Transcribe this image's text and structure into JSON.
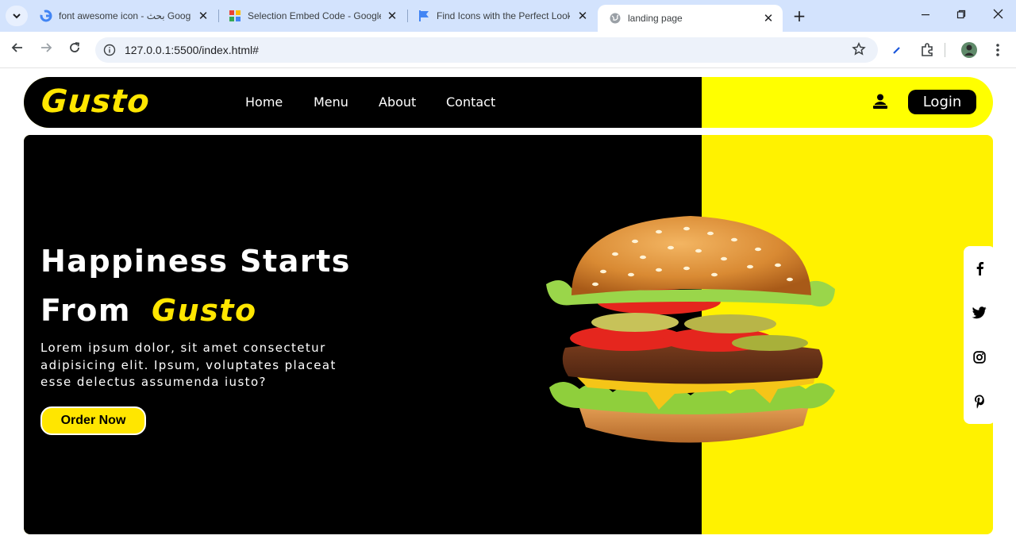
{
  "browser": {
    "tabs": [
      {
        "title": "font awesome icon - بحث Goog",
        "favicon": "google-g-icon",
        "active": false
      },
      {
        "title": "Selection Embed Code - Google",
        "favicon": "google-fonts-icon",
        "active": false
      },
      {
        "title": "Find Icons with the Perfect Look",
        "favicon": "flag-icon",
        "active": false
      },
      {
        "title": "landing page",
        "favicon": "globe-icon",
        "active": true
      }
    ],
    "close_glyph": "✕",
    "new_tab_glyph": "+",
    "url": "127.0.0.1:5500/index.html#"
  },
  "navbar": {
    "logo": "Gusto",
    "links": [
      "Home",
      "Menu",
      "About",
      "Contact"
    ],
    "login_label": "Login"
  },
  "hero": {
    "title_line1": "Happiness Starts",
    "title_line2_prefix": "From",
    "title_brand": "Gusto",
    "text": "Lorem ipsum dolor, sit amet consectetur adipisicing elit. Ipsum, voluptates placeat esse delectus assumenda iusto?",
    "order_label": "Order Now",
    "image": "burger-image"
  },
  "social": [
    "facebook-icon",
    "twitter-icon",
    "instagram-icon",
    "pinterest-icon"
  ],
  "colors": {
    "accent_yellow": "#ffe600",
    "navbar_yellow": "#ffff00",
    "black": "#000000",
    "tabbar": "#d3e3fd"
  }
}
